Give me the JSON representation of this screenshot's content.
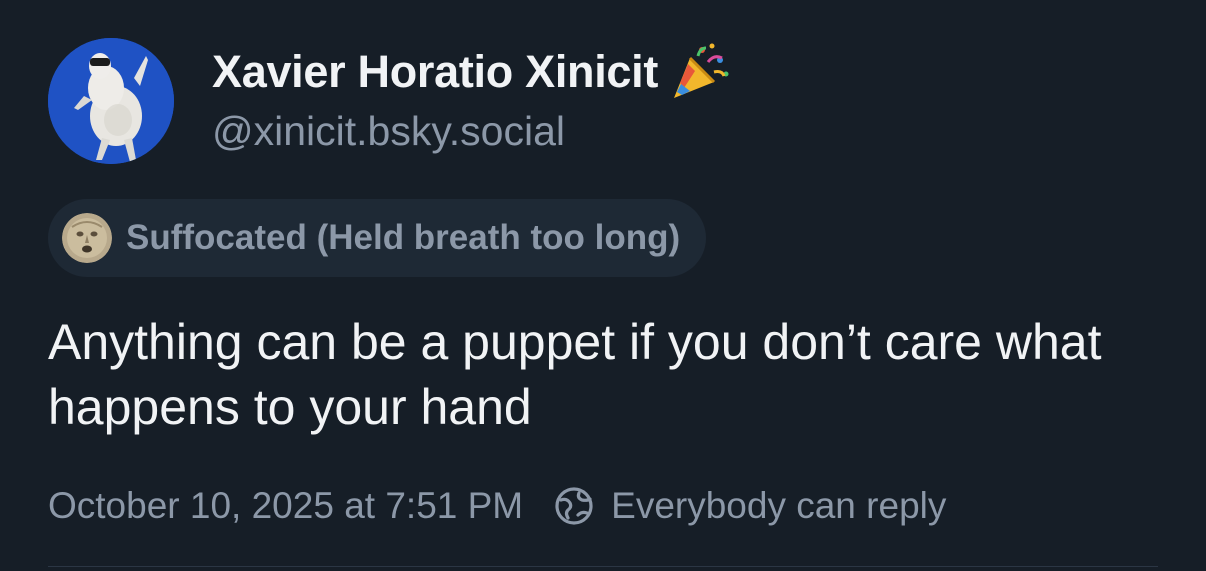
{
  "author": {
    "display_name": "Xavier Horatio Xinicit",
    "name_emoji": "party-popper-icon",
    "handle": "@xinicit.bsky.social",
    "avatar": "goat-avatar"
  },
  "label": {
    "text": "Suffocated (Held breath too long)",
    "icon": "stone-face-icon"
  },
  "post": {
    "text": "Anything can be a puppet if you don’t care what happens to your hand",
    "timestamp": "October 10, 2025 at 7:51 PM",
    "reply_setting": "Everybody can reply",
    "reply_icon": "globe-icon"
  },
  "colors": {
    "background": "#161e27",
    "text_primary": "#f1f3f5",
    "text_secondary": "#8c98a8",
    "pill_background": "#1e2935",
    "avatar_background": "#1f52c4"
  }
}
